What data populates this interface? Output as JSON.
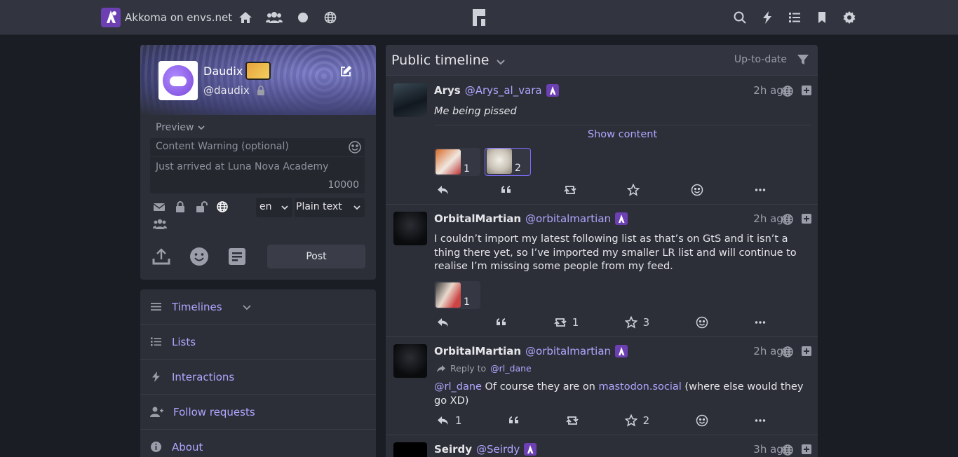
{
  "brand": {
    "title": "Akkoma on envs.net"
  },
  "nav": {
    "left_icons": [
      "home-icon",
      "users-icon",
      "circle-icon",
      "globe-icon"
    ],
    "right_icons": [
      "search-icon",
      "lightning-icon",
      "list-icon",
      "bookmark-icon",
      "gear-icon"
    ]
  },
  "profile": {
    "display_name": "Daudix",
    "handle": "@daudix"
  },
  "composer": {
    "preview_label": "Preview",
    "cw_placeholder": "Content Warning (optional)",
    "status_placeholder": "Just arrived at Luna Nova Academy",
    "char_limit": "10000",
    "language": "en",
    "format": "Plain text",
    "post_label": "Post"
  },
  "sidenav": {
    "items": [
      {
        "label": "Timelines",
        "icon": "bars-icon"
      },
      {
        "label": "Lists",
        "icon": "list-icon"
      },
      {
        "label": "Interactions",
        "icon": "lightning-icon"
      },
      {
        "label": "Follow requests",
        "icon": "user-plus-icon"
      },
      {
        "label": "About",
        "icon": "info-icon"
      }
    ]
  },
  "timeline": {
    "title": "Public timeline",
    "status": "Up-to-date",
    "posts": [
      {
        "name": "Arys",
        "handle": "@Arys_al_vara",
        "time": "2h ago",
        "text": "Me being pissed",
        "show_content": "Show content",
        "reactions": [
          "1",
          "2"
        ],
        "replies": "",
        "retoots": "",
        "favs": ""
      },
      {
        "name": "OrbitalMartian",
        "handle": "@orbitalmartian",
        "time": "2h ago",
        "text": "I couldn’t import my latest following list as that’s on GtS and it isn’t a thing there yet, so I’ve imported my smaller LR list and will continue to realise I’m missing some people from my feed.",
        "reactions": [
          "1"
        ],
        "replies": "",
        "retoots": "1",
        "favs": "3"
      },
      {
        "name": "OrbitalMartian",
        "handle": "@orbitalmartian",
        "time": "2h ago",
        "reply_to_label": "Reply to",
        "reply_to": "@rl_dane",
        "mention": "@rl_dane",
        "text_mid": " Of course they are on ",
        "link": "mastodon.social",
        "text_end": " (where else would they go XD)",
        "replies": "1",
        "retoots": "",
        "favs": "2"
      },
      {
        "name": "Seirdy",
        "handle": "@Seirdy",
        "time": "3h ago"
      }
    ]
  }
}
